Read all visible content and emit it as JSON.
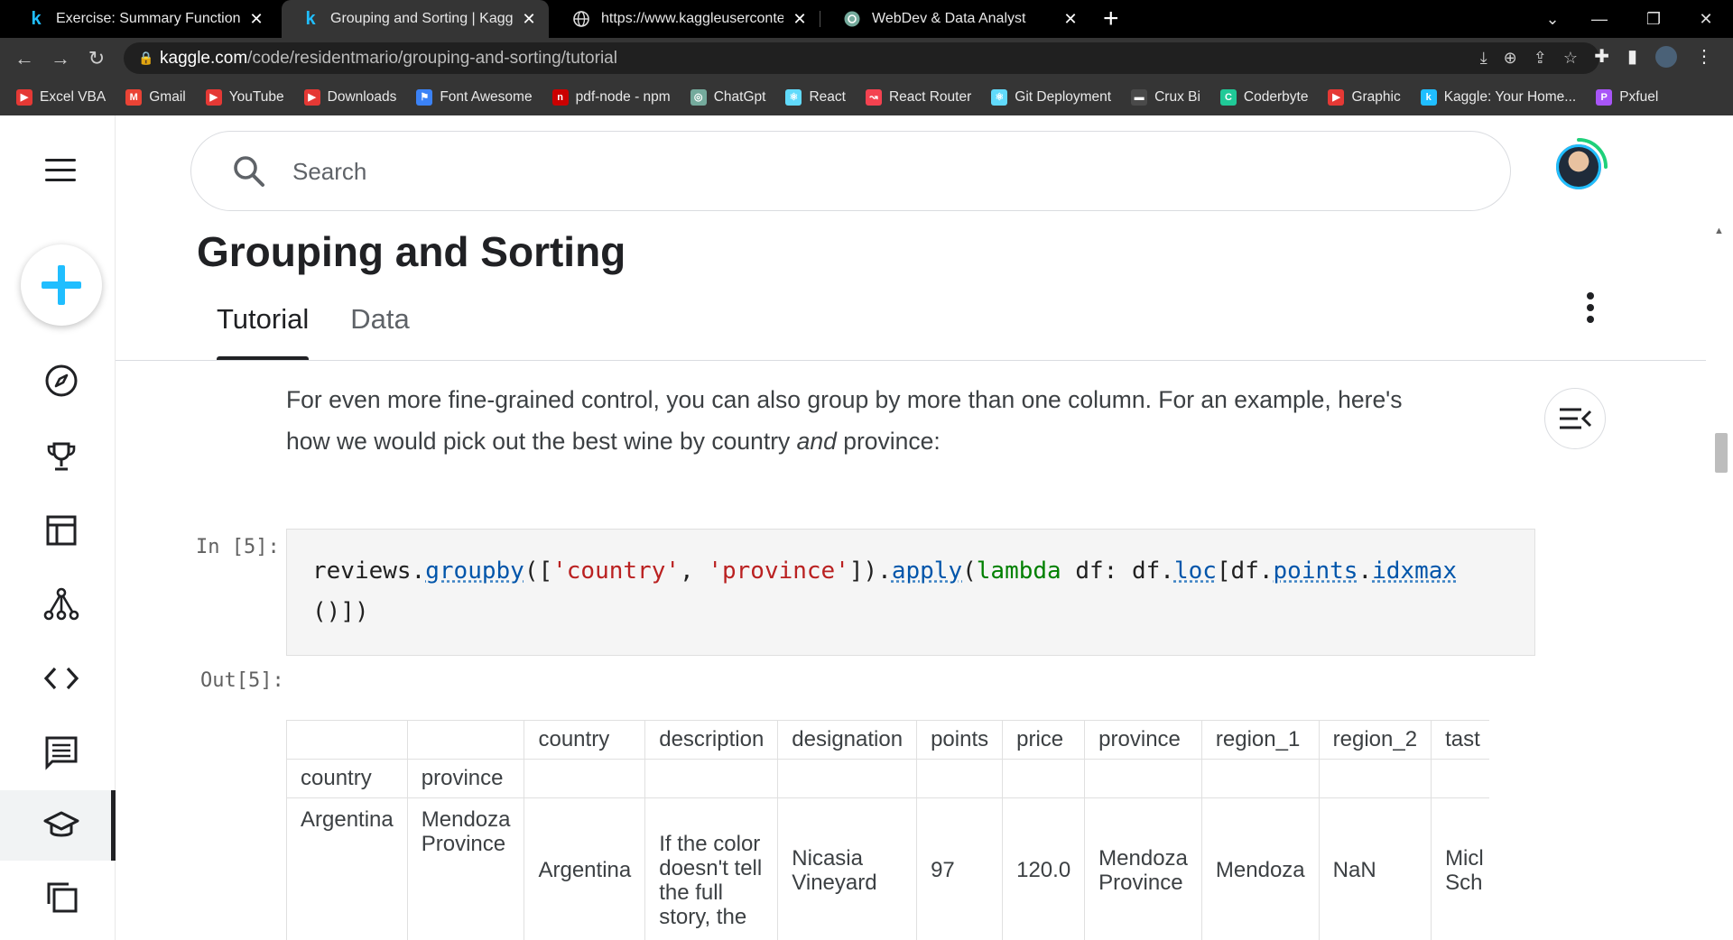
{
  "browser": {
    "tabs": [
      {
        "title": "Exercise: Summary Functions and",
        "icon": "kaggle-icon"
      },
      {
        "title": "Grouping and Sorting | Kaggle",
        "icon": "kaggle-icon",
        "active": true
      },
      {
        "title": "https://www.kaggleusercontent.c",
        "icon": "globe-icon"
      },
      {
        "title": "WebDev & Data Analyst",
        "icon": "chatgpt-icon"
      }
    ],
    "url_host": "kaggle.com",
    "url_path": "/code/residentmario/grouping-and-sorting/tutorial",
    "bookmarks": [
      {
        "label": "Excel VBA",
        "color": "#e53935",
        "icon": "youtube-icon"
      },
      {
        "label": "Gmail",
        "color": "#ea4335",
        "icon": "gmail-icon"
      },
      {
        "label": "YouTube",
        "color": "#e53935",
        "icon": "youtube-icon"
      },
      {
        "label": "Downloads",
        "color": "#e53935",
        "icon": "youtube-icon"
      },
      {
        "label": "Font Awesome",
        "color": "#3b82f6",
        "icon": "flag-icon"
      },
      {
        "label": "pdf-node - npm",
        "color": "#cb0000",
        "icon": "npm-icon"
      },
      {
        "label": "ChatGpt",
        "color": "#74aa9c",
        "icon": "chatgpt-icon"
      },
      {
        "label": "React",
        "color": "#61dafb",
        "icon": "react-icon"
      },
      {
        "label": "React Router",
        "color": "#f44250",
        "icon": "react-router-icon"
      },
      {
        "label": "Git Deployment",
        "color": "#61dafb",
        "icon": "react-icon"
      },
      {
        "label": "Crux Bi",
        "color": "#4a4a4a",
        "icon": "crux-icon"
      },
      {
        "label": "Coderbyte",
        "color": "#20c997",
        "icon": "coderbyte-icon"
      },
      {
        "label": "Graphic",
        "color": "#e53935",
        "icon": "youtube-icon"
      },
      {
        "label": "Kaggle: Your Home...",
        "color": "#20beff",
        "icon": "kaggle-icon"
      },
      {
        "label": "Pxfuel",
        "color": "#a855f7",
        "icon": "pxfuel-icon"
      }
    ]
  },
  "search": {
    "placeholder": "Search"
  },
  "page": {
    "title": "Grouping and Sorting",
    "tabs": [
      "Tutorial",
      "Data"
    ],
    "paragraph_1": "For even more fine-grained control, you can also group by more than one column. For an example, here's",
    "paragraph_2_pre": "how we would pick out the best wine by country ",
    "paragraph_2_em": "and",
    "paragraph_2_post": " province:",
    "in_prompt": "In [5]:",
    "out_prompt": "Out[5]:",
    "code": {
      "line1_a": "reviews.",
      "line1_b": "groupby",
      "line1_c": "([",
      "line1_d": "'country'",
      "line1_e": ", ",
      "line1_f": "'province'",
      "line1_g": "]).",
      "line1_h": "apply",
      "line1_i": "(",
      "line1_j": "lambda",
      "line1_k": " df: df.",
      "line1_l": "loc",
      "line1_m": "[df.",
      "line1_n": "points",
      "line1_o": ".",
      "line1_p": "idxmax",
      "line2": "()])"
    },
    "table": {
      "columns": [
        "country",
        "description",
        "designation",
        "points",
        "price",
        "province",
        "region_1",
        "region_2",
        "tast"
      ],
      "index_names": [
        "country",
        "province"
      ],
      "row": {
        "idx_country": "Argentina",
        "idx_province_1": "Mendoza",
        "idx_province_2": "Province",
        "country": "Argentina",
        "description_1": "If the color",
        "description_2": "doesn't tell",
        "description_3": "the full",
        "description_4": "story, the",
        "designation_1": "Nicasia",
        "designation_2": "Vineyard",
        "points": "97",
        "price": "120.0",
        "province_1": "Mendoza",
        "province_2": "Province",
        "region_1": "Mendoza",
        "region_2": "NaN",
        "taster_1": "Micl",
        "taster_2": "Sch"
      }
    }
  }
}
